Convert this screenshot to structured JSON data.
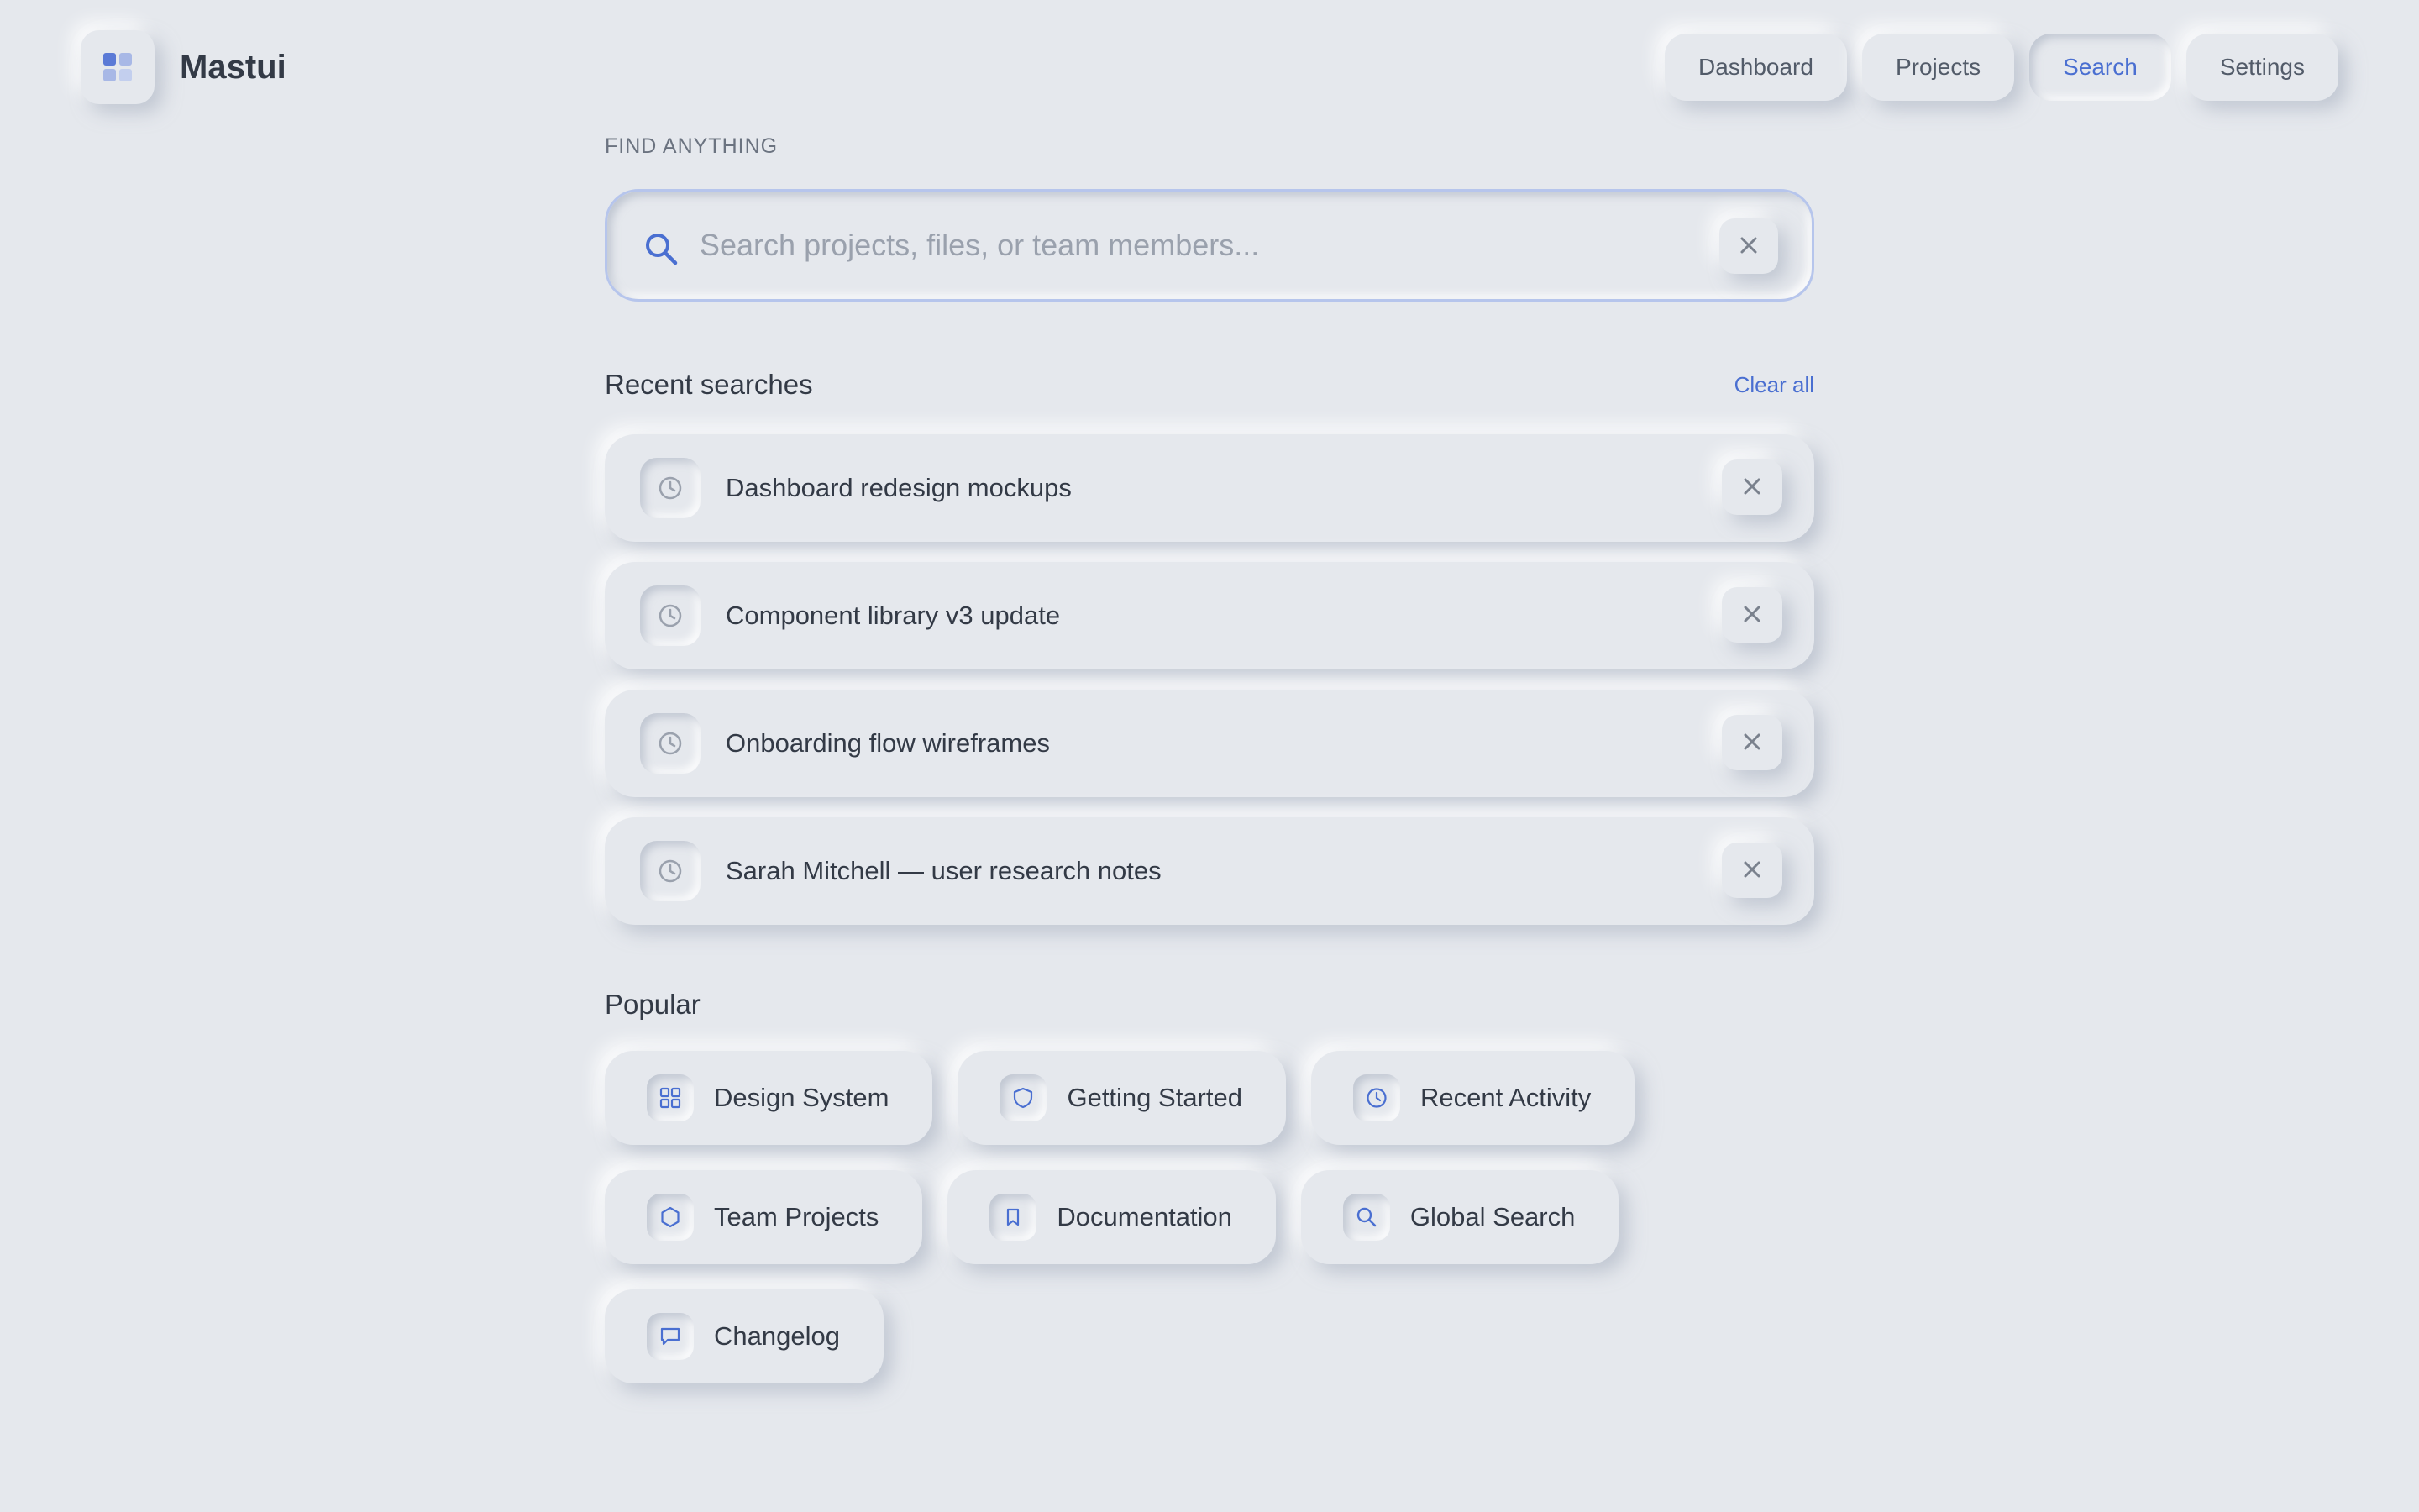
{
  "app": {
    "name": "Mastui",
    "logo_icon": "grid-logo-icon"
  },
  "nav": {
    "items": [
      {
        "label": "Dashboard",
        "active": false
      },
      {
        "label": "Projects",
        "active": false
      },
      {
        "label": "Search",
        "active": true
      },
      {
        "label": "Settings",
        "active": false
      }
    ]
  },
  "search": {
    "eyebrow": "FIND ANYTHING",
    "placeholder": "Search projects, files, or team members...",
    "value": "",
    "icon": "search-icon",
    "clear_icon": "close-icon"
  },
  "recent": {
    "title": "Recent searches",
    "clear_all": "Clear all",
    "items": [
      {
        "label": "Dashboard redesign mockups",
        "icon": "clock-icon"
      },
      {
        "label": "Component library v3 update",
        "icon": "clock-icon"
      },
      {
        "label": "Onboarding flow wireframes",
        "icon": "clock-icon"
      },
      {
        "label": "Sarah Mitchell — user research notes",
        "icon": "clock-icon"
      }
    ]
  },
  "popular": {
    "title": "Popular",
    "items": [
      {
        "label": "Design System",
        "icon": "grid-icon"
      },
      {
        "label": "Getting Started",
        "icon": "shield-icon"
      },
      {
        "label": "Recent Activity",
        "icon": "clock-icon"
      },
      {
        "label": "Team Projects",
        "icon": "hexagon-icon"
      },
      {
        "label": "Documentation",
        "icon": "bookmark-icon"
      },
      {
        "label": "Global Search",
        "icon": "search-icon"
      },
      {
        "label": "Changelog",
        "icon": "chat-icon"
      }
    ]
  },
  "colors": {
    "background": "#e5e8ed",
    "accent": "#4a6fd1",
    "text": "#333a46",
    "muted": "#9aa1ad"
  }
}
